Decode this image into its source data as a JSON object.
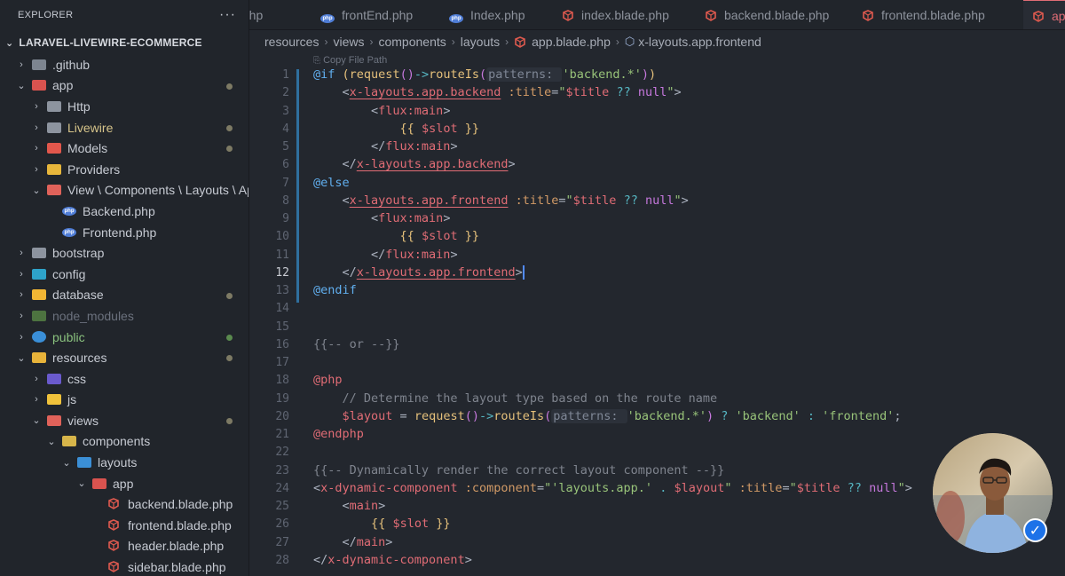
{
  "explorer": {
    "title": "EXPLORER",
    "more": "···",
    "root": "LARAVEL-LIVEWIRE-ECOMMERCE",
    "items": [
      {
        "label": ".github",
        "indent": 0,
        "chev": "›",
        "icon": "folder-github-icon"
      },
      {
        "label": "app",
        "indent": 0,
        "chev": "⌄",
        "icon": "folder-app-icon",
        "dot": true
      },
      {
        "label": "Http",
        "indent": 1,
        "chev": "›",
        "icon": "folder-icon"
      },
      {
        "label": "Livewire",
        "indent": 1,
        "chev": "›",
        "icon": "folder-livewire-icon",
        "dot": true
      },
      {
        "label": "Models",
        "indent": 1,
        "chev": "›",
        "icon": "folder-models-icon",
        "dot": true
      },
      {
        "label": "Providers",
        "indent": 1,
        "chev": "›",
        "icon": "folder-providers-icon"
      },
      {
        "label": "View \\ Components \\ Layouts \\ App",
        "indent": 1,
        "chev": "⌄",
        "icon": "folder-views-icon"
      },
      {
        "label": "Backend.php",
        "indent": 2,
        "chev": "",
        "icon": "php-icon"
      },
      {
        "label": "Frontend.php",
        "indent": 2,
        "chev": "",
        "icon": "php-icon"
      },
      {
        "label": "bootstrap",
        "indent": 0,
        "chev": "›",
        "icon": "folder-icon"
      },
      {
        "label": "config",
        "indent": 0,
        "chev": "›",
        "icon": "folder-config-icon"
      },
      {
        "label": "database",
        "indent": 0,
        "chev": "›",
        "icon": "folder-database-icon",
        "dot": true
      },
      {
        "label": "node_modules",
        "indent": 0,
        "chev": "›",
        "icon": "folder-node-icon",
        "dim": true
      },
      {
        "label": "public",
        "indent": 0,
        "chev": "›",
        "icon": "folder-public-icon",
        "dot": true,
        "dotColor": "green"
      },
      {
        "label": "resources",
        "indent": 0,
        "chev": "⌄",
        "icon": "folder-resources-icon",
        "dot": true
      },
      {
        "label": "css",
        "indent": 1,
        "chev": "›",
        "icon": "folder-css-icon"
      },
      {
        "label": "js",
        "indent": 1,
        "chev": "›",
        "icon": "folder-js-icon"
      },
      {
        "label": "views",
        "indent": 1,
        "chev": "⌄",
        "icon": "folder-views-icon",
        "dot": true
      },
      {
        "label": "components",
        "indent": 2,
        "chev": "⌄",
        "icon": "folder-components-icon"
      },
      {
        "label": "layouts",
        "indent": 3,
        "chev": "⌄",
        "icon": "folder-layouts-icon"
      },
      {
        "label": "app",
        "indent": 4,
        "chev": "⌄",
        "icon": "folder-app-icon"
      },
      {
        "label": "backend.blade.php",
        "indent": 5,
        "chev": "",
        "icon": "blade-icon"
      },
      {
        "label": "frontend.blade.php",
        "indent": 5,
        "chev": "",
        "icon": "blade-icon"
      },
      {
        "label": "header.blade.php",
        "indent": 5,
        "chev": "",
        "icon": "blade-icon"
      },
      {
        "label": "sidebar.blade.php",
        "indent": 5,
        "chev": "",
        "icon": "blade-icon"
      }
    ]
  },
  "tabs": [
    {
      "label": ".php",
      "icon": ""
    },
    {
      "label": "frontEnd.php",
      "icon": "php-icon"
    },
    {
      "label": "Index.php",
      "icon": "php-icon"
    },
    {
      "label": "index.blade.php",
      "icon": "blade-icon"
    },
    {
      "label": "backend.blade.php",
      "icon": "blade-icon"
    },
    {
      "label": "frontend.blade.php",
      "icon": "blade-icon"
    },
    {
      "label": "app",
      "icon": "blade-icon",
      "active": true
    }
  ],
  "breadcrumb": {
    "parts": [
      "resources",
      "views",
      "components",
      "layouts"
    ],
    "file": "app.blade.php",
    "symbol": "x-layouts.app.frontend"
  },
  "editor": {
    "codelens": "Copy File Path",
    "current_line": 12,
    "lines": [
      "<span class=\"dir\">@if</span> <span class=\"brk\">(</span><span class=\"fn\">request</span><span class=\"k\">()</span><span class=\"op\">-></span><span class=\"fn\">routeIs</span><span class=\"k\">(</span><span class=\"hint\">patterns: </span><span class=\"s\">'backend.*'</span><span class=\"k\">)</span><span class=\"brk\">)</span>",
      "    &lt;<span class=\"tag ul\">x-layouts.app.backend</span> <span class=\"attr\">:title</span>=<span class=\"s\">\"</span><span class=\"vr\">$title</span> <span class=\"op\">??</span> <span class=\"k\">null</span><span class=\"s\">\"</span>&gt;",
      "        &lt;<span class=\"tag\">flux:main</span>&gt;",
      "            <span class=\"fn\">{{</span> <span class=\"vr\">$slot</span> <span class=\"fn\">}}</span>",
      "        &lt;/<span class=\"tag\">flux:main</span>&gt;",
      "    &lt;/<span class=\"tag ul\">x-layouts.app.backend</span>&gt;",
      "<span class=\"dir\">@else</span>",
      "    &lt;<span class=\"tag ul\">x-layouts.app.frontend</span> <span class=\"attr\">:title</span>=<span class=\"s\">\"</span><span class=\"vr\">$title</span> <span class=\"op\">??</span> <span class=\"k\">null</span><span class=\"s\">\"</span>&gt;",
      "        &lt;<span class=\"tag\">flux:main</span>&gt;",
      "            <span class=\"fn\">{{</span> <span class=\"vr\">$slot</span> <span class=\"fn\">}}</span>",
      "        &lt;/<span class=\"tag\">flux:main</span>&gt;",
      "    &lt;/<span class=\"tag ul\">x-layouts.app.frontend</span>&gt;<span class=\"cursor\"></span>",
      "<span class=\"dir\">@endif</span>",
      "",
      "",
      "<span class=\"cm\">{{-- or --}}</span>",
      "",
      "<span class=\"dirr\">@php</span>",
      "    <span class=\"cm\">// Determine the layout type based on the route name</span>",
      "    <span class=\"vr\">$layout</span> = <span class=\"fn\">request</span><span class=\"k\">()</span><span class=\"op\">-></span><span class=\"fn\">routeIs</span><span class=\"k\">(</span><span class=\"hint\">patterns: </span><span class=\"s\">'backend.*'</span><span class=\"k\">)</span> <span class=\"op\">?</span> <span class=\"s\">'backend'</span> <span class=\"op\">:</span> <span class=\"s\">'frontend'</span>;",
      "<span class=\"dirr\">@endphp</span>",
      "",
      "<span class=\"cm\">{{-- Dynamically render the correct layout component --}}</span>",
      "&lt;<span class=\"tag\">x-dynamic-component</span> <span class=\"attr\">:component</span>=<span class=\"s\">\"'layouts.app.'</span> <span class=\"op\">.</span> <span class=\"vr\">$layout</span><span class=\"s\">\"</span> <span class=\"attr\">:title</span>=<span class=\"s\">\"</span><span class=\"vr\">$title</span> <span class=\"op\">??</span> <span class=\"k\">null</span><span class=\"s\">\"</span>&gt;",
      "    &lt;<span class=\"tag\">main</span>&gt;",
      "        <span class=\"fn\">{{</span> <span class=\"vr\">$slot</span> <span class=\"fn\">}}</span>",
      "    &lt;/<span class=\"tag\">main</span>&gt;",
      "&lt;/<span class=\"tag\">x-dynamic-component</span>&gt;"
    ]
  },
  "overlay": {
    "avatar": "profile-photo",
    "badge": "✓"
  }
}
